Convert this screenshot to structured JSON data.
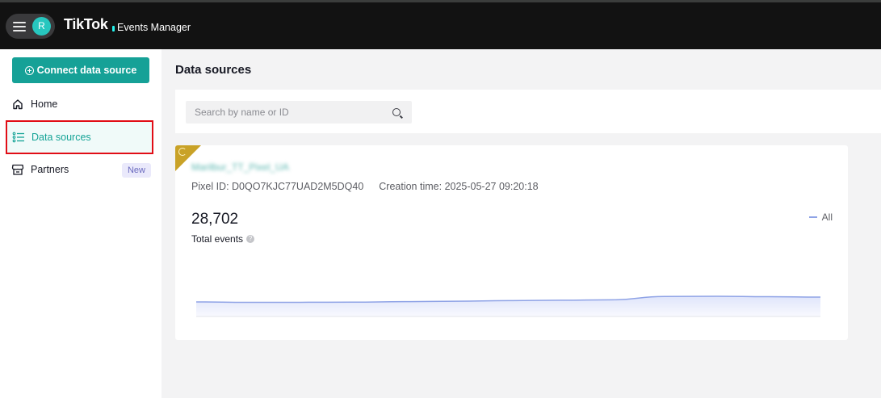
{
  "header": {
    "avatar_initial": "R",
    "brand": "TikTok",
    "product": "Events Manager"
  },
  "sidebar": {
    "connect_label": "Connect data source",
    "items": [
      {
        "label": "Home",
        "icon": "home-icon"
      },
      {
        "label": "Data sources",
        "icon": "list-icon",
        "active": true
      },
      {
        "label": "Partners",
        "icon": "store-icon",
        "badge": "New"
      }
    ]
  },
  "main": {
    "title": "Data sources",
    "search": {
      "placeholder": "Search by name or ID",
      "value": ""
    },
    "card": {
      "pixel_name": "Marilbur_TT_Pixel_UA",
      "pixel_id_label": "Pixel ID:",
      "pixel_id": "D0QO7KJC77UAD2M5DQ40",
      "creation_label": "Creation time:",
      "creation_time": "2025-05-27 09:20:18",
      "total_value": "28,702",
      "total_label": "Total events",
      "legend": "All"
    }
  },
  "colors": {
    "accent": "#16a197",
    "highlight_border": "#e10d16",
    "line": "#8fa3e6"
  },
  "chart_data": {
    "type": "area",
    "series": [
      {
        "name": "All",
        "values": [
          0.62,
          0.6,
          0.6,
          0.61,
          0.63,
          0.65,
          0.68,
          0.7,
          0.72,
          0.88,
          0.89,
          0.87,
          0.85
        ]
      }
    ],
    "ylim": [
      0,
      1
    ],
    "grid": false
  }
}
